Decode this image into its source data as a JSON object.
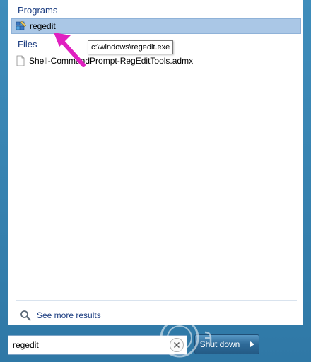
{
  "start_menu": {
    "programs_header": "Programs",
    "files_header": "Files",
    "programs": [
      {
        "label": "regedit",
        "icon": "regedit-icon",
        "selected": true
      }
    ],
    "files": [
      {
        "label": "Shell-CommandPrompt-RegEditTools.admx",
        "icon": "file-icon"
      }
    ],
    "tooltip": "c:\\windows\\regedit.exe",
    "see_more": "See more results",
    "search": {
      "value": "regedit"
    },
    "shutdown_label": "Shut down"
  },
  "colors": {
    "accent": "#1e3f82",
    "selection": "#aac7e6",
    "annotation_arrow": "#e020c0",
    "taskbar": "#3f8dbb"
  }
}
